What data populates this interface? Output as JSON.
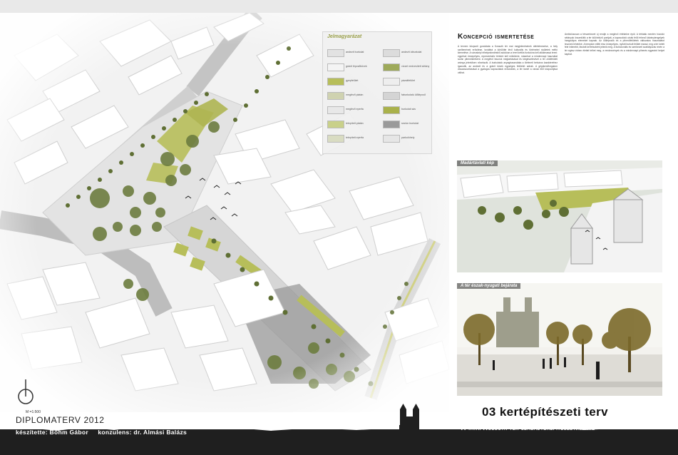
{
  "legend": {
    "title": "Jelmagyarázat",
    "items_left": [
      "andezit burkolat",
      "gránit lépcsőkövek",
      "gyepfelület",
      "meglévő platán",
      "meglévő eperfa",
      "telepített platán",
      "telepített eperfa"
    ],
    "items_right": [
      "andezit útburkolat",
      "vízzel nedvesített sétány",
      "pázsitfelület",
      "faburkolatú ülőlépcső",
      "burkolati sáv",
      "sezlon burkolat",
      "parkolóhely"
    ]
  },
  "concept": {
    "title": "Koncepció ismertetése",
    "col1": "A tervem központi gondolata a Kossuth tér mai megjelenésének átértelmezése, a hely szellemének erősítése, továbbá a körülötte lévő kulturális és történelmi épületek méltó kiemelése. A városképi elhelyezkedésből adódóan a teret kettős funkcióra kell alkalmassá tenni: egyrészt ünnepélyes, reprezentatív térként kell működnie, másrészt a mindennapi használat során pihenőkertként. A meglévő fasorok megtartásával és kiegészítésével a tér zöldfelületi aránya jelentősen növekszik. A burkolatok anyaghasználata a történeti belváros karakteréhez igazodik, az andezit és a gránit kövek egységes felületet adnak. A gépjárműforgalom visszaszorításával a gyalogos kapcsolatok erősödnek, a tér ismét a városi élet központjává válhat.",
    "col2": "Ambiciózusan a térszerkezet új rendje a meglévő értékekre épül. A térfalak mentén húzódó sétányok összekötik a tér különböző pontjait, a kapcsolódó utcák felől érkező látványtengelyek hangsúlyos elemeket kapnak. Az ülőlépcsők és a pihenőfelületek változatos használatot tesznek lehetővé. A templom előtti rész ünnepélyes, nyitott burkolt felület marad, míg a tér keleti fele intimebb, fásított kertrészként jelenik meg. A funkcionális és szerkezeti szabályozás révén a tér egész évben élettel telhet meg, a rendezvények és a mindennapi pihenés egyaránt helyet kaphat."
  },
  "views": {
    "top_label": "Madártávlati kép",
    "bottom_label": "A tér észak-nyugati bejárata"
  },
  "footer": {
    "scale": "M =1:500",
    "diploma": "DIPLOMATERV 2012",
    "credits": "készítette: Böhm Gábor     konzulens: dr. Almási Balázs",
    "main_title": "03 kertépítészeti terv",
    "sub_title": "A tatai Kossuth tér szabadtérépítészeti terve"
  },
  "colors": {
    "lawn": "#b7be5a",
    "tree": "#6b7a3e",
    "paving": "#d8d8d8",
    "dark_paving": "#8c8c8c",
    "skyline": "#1f1f1f"
  }
}
